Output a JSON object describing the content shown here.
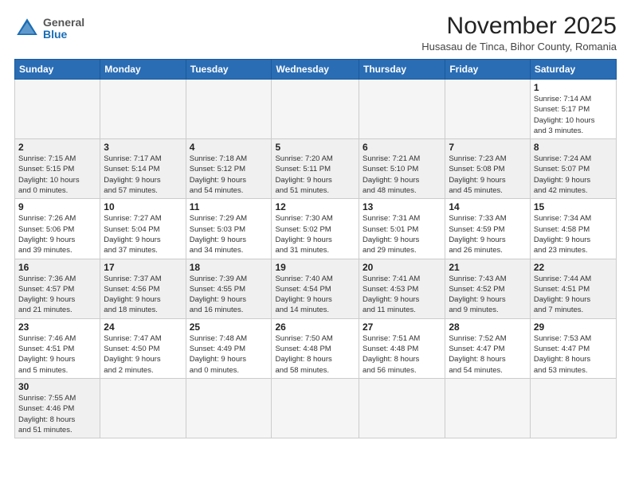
{
  "logo": {
    "general": "General",
    "blue": "Blue"
  },
  "title": "November 2025",
  "subtitle": "Husasau de Tinca, Bihor County, Romania",
  "weekdays": [
    "Sunday",
    "Monday",
    "Tuesday",
    "Wednesday",
    "Thursday",
    "Friday",
    "Saturday"
  ],
  "weeks": [
    [
      {
        "day": "",
        "info": ""
      },
      {
        "day": "",
        "info": ""
      },
      {
        "day": "",
        "info": ""
      },
      {
        "day": "",
        "info": ""
      },
      {
        "day": "",
        "info": ""
      },
      {
        "day": "",
        "info": ""
      },
      {
        "day": "1",
        "info": "Sunrise: 7:14 AM\nSunset: 5:17 PM\nDaylight: 10 hours\nand 3 minutes."
      }
    ],
    [
      {
        "day": "2",
        "info": "Sunrise: 7:15 AM\nSunset: 5:15 PM\nDaylight: 10 hours\nand 0 minutes."
      },
      {
        "day": "3",
        "info": "Sunrise: 7:17 AM\nSunset: 5:14 PM\nDaylight: 9 hours\nand 57 minutes."
      },
      {
        "day": "4",
        "info": "Sunrise: 7:18 AM\nSunset: 5:12 PM\nDaylight: 9 hours\nand 54 minutes."
      },
      {
        "day": "5",
        "info": "Sunrise: 7:20 AM\nSunset: 5:11 PM\nDaylight: 9 hours\nand 51 minutes."
      },
      {
        "day": "6",
        "info": "Sunrise: 7:21 AM\nSunset: 5:10 PM\nDaylight: 9 hours\nand 48 minutes."
      },
      {
        "day": "7",
        "info": "Sunrise: 7:23 AM\nSunset: 5:08 PM\nDaylight: 9 hours\nand 45 minutes."
      },
      {
        "day": "8",
        "info": "Sunrise: 7:24 AM\nSunset: 5:07 PM\nDaylight: 9 hours\nand 42 minutes."
      }
    ],
    [
      {
        "day": "9",
        "info": "Sunrise: 7:26 AM\nSunset: 5:06 PM\nDaylight: 9 hours\nand 39 minutes."
      },
      {
        "day": "10",
        "info": "Sunrise: 7:27 AM\nSunset: 5:04 PM\nDaylight: 9 hours\nand 37 minutes."
      },
      {
        "day": "11",
        "info": "Sunrise: 7:29 AM\nSunset: 5:03 PM\nDaylight: 9 hours\nand 34 minutes."
      },
      {
        "day": "12",
        "info": "Sunrise: 7:30 AM\nSunset: 5:02 PM\nDaylight: 9 hours\nand 31 minutes."
      },
      {
        "day": "13",
        "info": "Sunrise: 7:31 AM\nSunset: 5:01 PM\nDaylight: 9 hours\nand 29 minutes."
      },
      {
        "day": "14",
        "info": "Sunrise: 7:33 AM\nSunset: 4:59 PM\nDaylight: 9 hours\nand 26 minutes."
      },
      {
        "day": "15",
        "info": "Sunrise: 7:34 AM\nSunset: 4:58 PM\nDaylight: 9 hours\nand 23 minutes."
      }
    ],
    [
      {
        "day": "16",
        "info": "Sunrise: 7:36 AM\nSunset: 4:57 PM\nDaylight: 9 hours\nand 21 minutes."
      },
      {
        "day": "17",
        "info": "Sunrise: 7:37 AM\nSunset: 4:56 PM\nDaylight: 9 hours\nand 18 minutes."
      },
      {
        "day": "18",
        "info": "Sunrise: 7:39 AM\nSunset: 4:55 PM\nDaylight: 9 hours\nand 16 minutes."
      },
      {
        "day": "19",
        "info": "Sunrise: 7:40 AM\nSunset: 4:54 PM\nDaylight: 9 hours\nand 14 minutes."
      },
      {
        "day": "20",
        "info": "Sunrise: 7:41 AM\nSunset: 4:53 PM\nDaylight: 9 hours\nand 11 minutes."
      },
      {
        "day": "21",
        "info": "Sunrise: 7:43 AM\nSunset: 4:52 PM\nDaylight: 9 hours\nand 9 minutes."
      },
      {
        "day": "22",
        "info": "Sunrise: 7:44 AM\nSunset: 4:51 PM\nDaylight: 9 hours\nand 7 minutes."
      }
    ],
    [
      {
        "day": "23",
        "info": "Sunrise: 7:46 AM\nSunset: 4:51 PM\nDaylight: 9 hours\nand 5 minutes."
      },
      {
        "day": "24",
        "info": "Sunrise: 7:47 AM\nSunset: 4:50 PM\nDaylight: 9 hours\nand 2 minutes."
      },
      {
        "day": "25",
        "info": "Sunrise: 7:48 AM\nSunset: 4:49 PM\nDaylight: 9 hours\nand 0 minutes."
      },
      {
        "day": "26",
        "info": "Sunrise: 7:50 AM\nSunset: 4:48 PM\nDaylight: 8 hours\nand 58 minutes."
      },
      {
        "day": "27",
        "info": "Sunrise: 7:51 AM\nSunset: 4:48 PM\nDaylight: 8 hours\nand 56 minutes."
      },
      {
        "day": "28",
        "info": "Sunrise: 7:52 AM\nSunset: 4:47 PM\nDaylight: 8 hours\nand 54 minutes."
      },
      {
        "day": "29",
        "info": "Sunrise: 7:53 AM\nSunset: 4:47 PM\nDaylight: 8 hours\nand 53 minutes."
      }
    ],
    [
      {
        "day": "30",
        "info": "Sunrise: 7:55 AM\nSunset: 4:46 PM\nDaylight: 8 hours\nand 51 minutes."
      },
      {
        "day": "",
        "info": ""
      },
      {
        "day": "",
        "info": ""
      },
      {
        "day": "",
        "info": ""
      },
      {
        "day": "",
        "info": ""
      },
      {
        "day": "",
        "info": ""
      },
      {
        "day": "",
        "info": ""
      }
    ]
  ]
}
